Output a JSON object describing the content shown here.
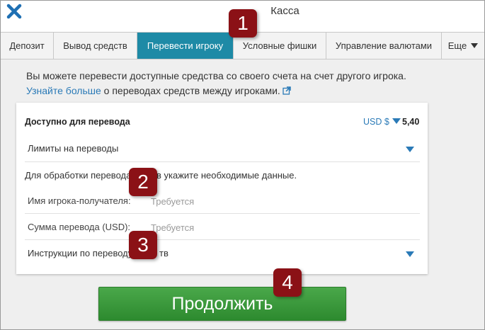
{
  "window": {
    "title": "Касса",
    "close_icon": "close-x-icon"
  },
  "tabs": [
    {
      "label": "Депозит",
      "active": false
    },
    {
      "label": "Вывод средств",
      "active": false
    },
    {
      "label": "Перевести игроку",
      "active": true
    },
    {
      "label": "Условные фишки",
      "active": false
    },
    {
      "label": "Управление валютами",
      "active": false
    },
    {
      "label": "Еще",
      "active": false
    }
  ],
  "intro": {
    "text_before": "Вы можете перевести доступные средства со своего счета на счет другого игрока.",
    "link": "Узнайте больше",
    "text_after": "о переводах средств между игроками."
  },
  "card": {
    "available_label": "Доступно для перевода",
    "currency": "USD $",
    "amount": "5,40",
    "limits_label": "Лимиты на переводы",
    "instruction": "Для обработки перевода",
    "instruction_tail": "в укажите необходимые данные.",
    "recipient_label": "Имя игрока-получателя:",
    "recipient_placeholder": "Требуется",
    "amount_label": "Сумма перевода (USD):",
    "amount_placeholder": "Требуется",
    "instructions_row_label": "Инструкции по переводу",
    "instructions_row_tail": "тв"
  },
  "continue_label": "Продолжить",
  "badges": [
    "1",
    "2",
    "3",
    "4"
  ],
  "colors": {
    "accent_tab": "#1e8aa6",
    "link": "#2a7ab7",
    "button_green": "#3a9a3c",
    "badge_red": "#8b1116",
    "close_icon": "#1e6fb3"
  }
}
